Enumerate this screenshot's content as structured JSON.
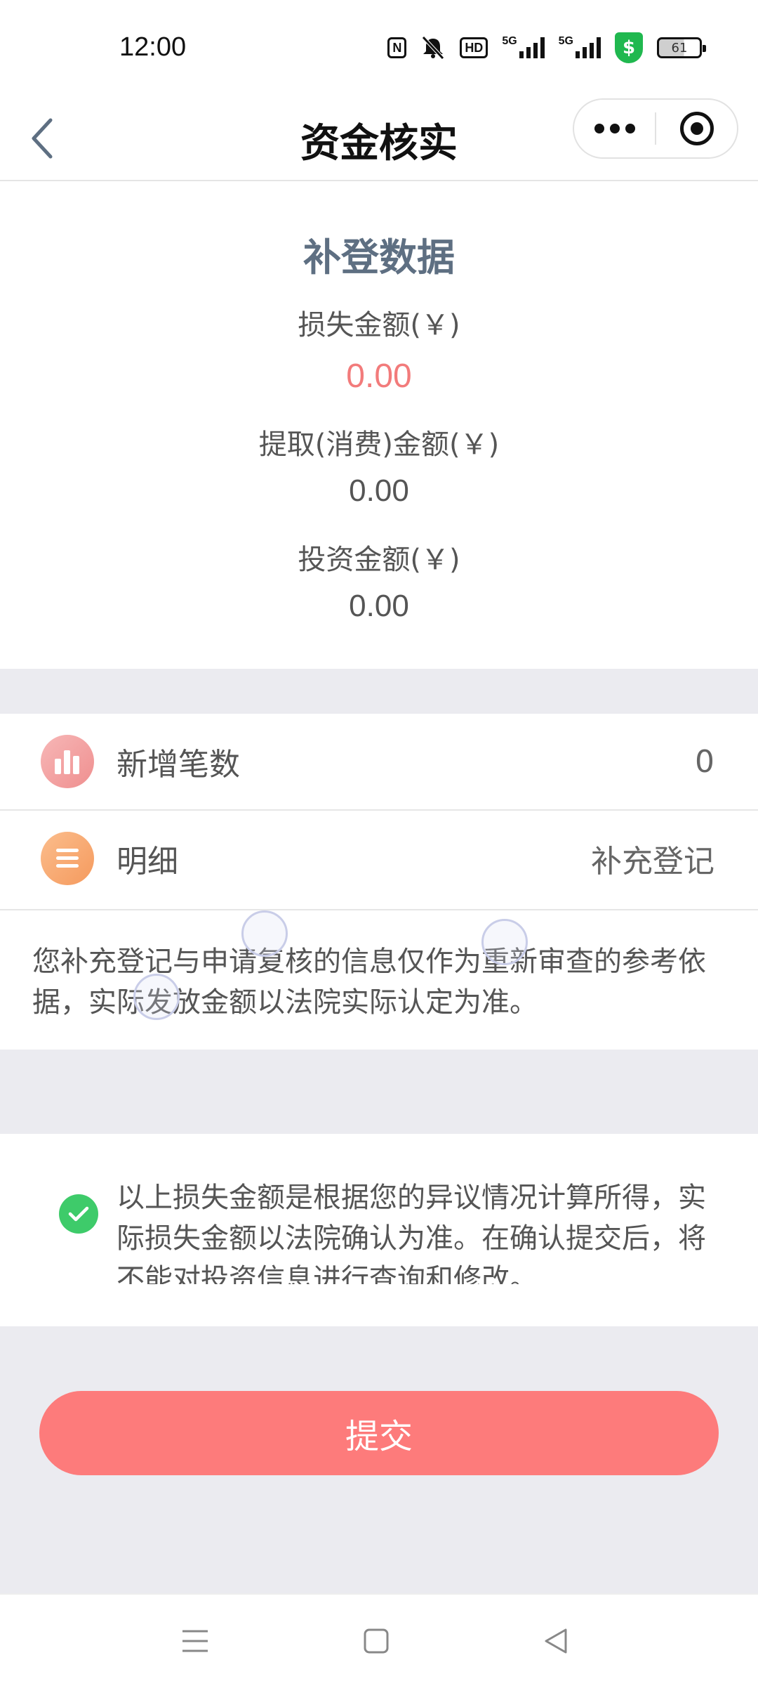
{
  "status_bar": {
    "time": "12:00",
    "icons": [
      "nfc-icon",
      "mute-icon",
      "hd-icon",
      "signal-5g-icon",
      "signal-5g-icon",
      "security-shield-icon",
      "battery-icon"
    ],
    "hd_label": "HD",
    "network_label": "5G",
    "battery_level": "61"
  },
  "title_bar": {
    "title": "资金核实"
  },
  "summary": {
    "title": "补登数据",
    "loss_label": "损失金额(￥)",
    "loss_value": "0.00",
    "withdraw_label": "提取(消费)金额(￥)",
    "withdraw_value": "0.00",
    "invest_label": "投资金额(￥)",
    "invest_value": "0.00",
    "loss_color": "#f27b7b"
  },
  "rows": [
    {
      "label": "新增笔数",
      "value": "0",
      "icon": "bar-chart-icon",
      "icon_color": "#f39b9b"
    },
    {
      "label": "明细",
      "value": "补充登记",
      "icon": "list-icon",
      "icon_color": "#f9a56d"
    }
  ],
  "note": {
    "text": "您补充登记与申请复核的信息仅作为重新审查的参考依据，实际发放金额以法院实际认定为准。"
  },
  "agreement": {
    "checked": true,
    "text": "以上损失金额是根据您的异议情况计算所得，实际损失金额以法院确认为准。在确认提交后，将不能对投资信息进行查询和修改。"
  },
  "submit": {
    "label": "提交",
    "color": "#fd7b7b"
  },
  "nav_bar": {
    "items": [
      "menu-icon",
      "home-icon",
      "back-icon"
    ]
  }
}
